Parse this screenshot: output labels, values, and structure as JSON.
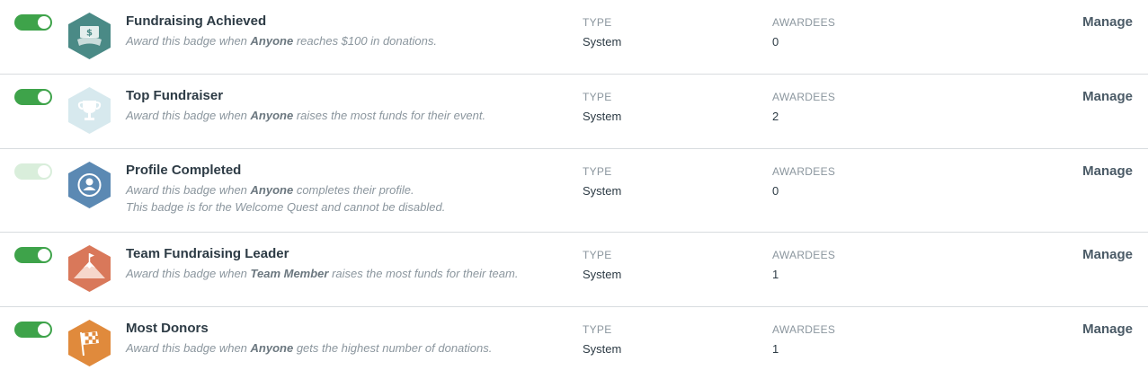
{
  "columns": {
    "type_label": "TYPE",
    "awardees_label": "AWARDEES"
  },
  "manage_label": "Manage",
  "badges": [
    {
      "name": "Fundraising Achieved",
      "desc_pre": "Award this badge when ",
      "desc_who": "Anyone",
      "desc_post": " reaches $100 in donations.",
      "note": "",
      "type": "System",
      "awardees": "0",
      "enabled": true,
      "icon": "money-icon",
      "color": "#4a8a86"
    },
    {
      "name": "Top Fundraiser",
      "desc_pre": "Award this badge when ",
      "desc_who": "Anyone",
      "desc_post": " raises the most funds for their event.",
      "note": "",
      "type": "System",
      "awardees": "2",
      "enabled": true,
      "icon": "trophy-icon",
      "color": "#d7e9ee"
    },
    {
      "name": "Profile Completed",
      "desc_pre": "Award this badge when ",
      "desc_who": "Anyone",
      "desc_post": " completes their profile.",
      "note": "This badge is for the Welcome Quest and cannot be disabled.",
      "type": "System",
      "awardees": "0",
      "enabled": true,
      "locked": true,
      "icon": "user-profile-icon",
      "color": "#5b89b3"
    },
    {
      "name": "Team Fundraising Leader",
      "desc_pre": "Award this badge when ",
      "desc_who": "Team Member",
      "desc_post": " raises the most funds for their team.",
      "note": "",
      "type": "System",
      "awardees": "1",
      "enabled": true,
      "icon": "mountain-flag-icon",
      "color": "#d9785a"
    },
    {
      "name": "Most Donors",
      "desc_pre": "Award this badge when ",
      "desc_who": "Anyone",
      "desc_post": " gets the highest number of donations.",
      "note": "",
      "type": "System",
      "awardees": "1",
      "enabled": true,
      "icon": "checkered-flag-icon",
      "color": "#e08a3c"
    }
  ],
  "toggle_colors": {
    "on": "#3ea34a",
    "locked": "#d9eedb"
  }
}
